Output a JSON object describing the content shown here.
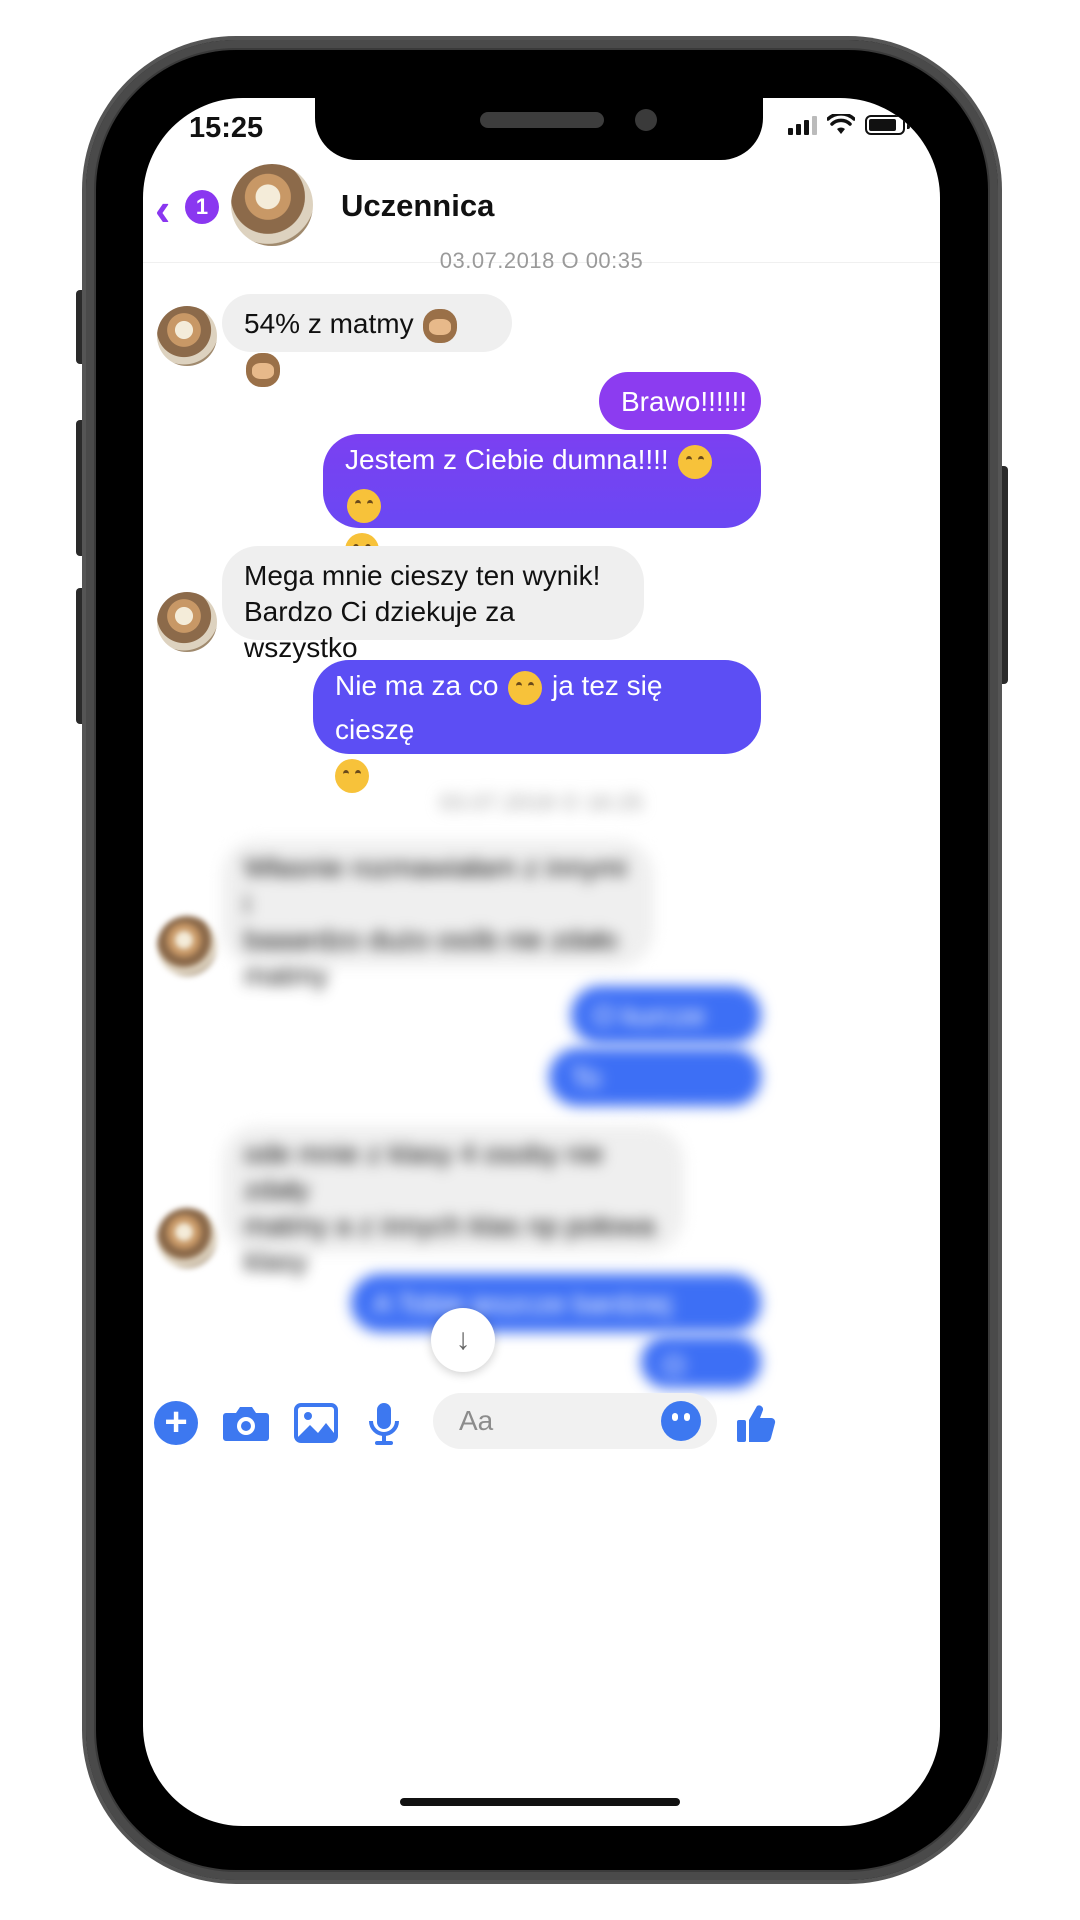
{
  "status_bar": {
    "time": "15:25"
  },
  "header": {
    "back_badge_count": "1",
    "contact_name": "Uczennica"
  },
  "conversation": {
    "timestamp_1": "03.07.2018 O 00:35",
    "timestamp_2": "03.07.2018 O 16:25",
    "messages": [
      {
        "direction": "in",
        "text": "54% z matmy",
        "emoji": [
          "see-no-evil-monkey",
          "see-no-evil-monkey"
        ]
      },
      {
        "direction": "out",
        "text": "Brawo!!!!!!"
      },
      {
        "direction": "out",
        "text": "Jestem z Ciebie dumna!!!!",
        "emoji": [
          "smiling-face",
          "smiling-face",
          "smiling-face"
        ]
      },
      {
        "direction": "in",
        "text_line_1": "Mega mnie cieszy ten wynik!",
        "text_line_2": "Bardzo Ci dziekuje za wszystko"
      },
      {
        "direction": "out",
        "text_before": "Nie ma za co",
        "text_after": "ja tez się cieszę",
        "emoji": [
          "smiling-face",
          "grinning-face"
        ]
      },
      {
        "direction": "in",
        "blurred": true,
        "text_line_1": "Własnie rozmawiałam z innymi i",
        "text_line_2": "baaardzo dużo osób nie zdało",
        "text_line_3": "matmy"
      },
      {
        "direction": "out",
        "blurred": true,
        "text": "O kurcze"
      },
      {
        "direction": "out",
        "blurred": true,
        "text": "To współczuję"
      },
      {
        "direction": "in",
        "blurred": true,
        "text_line_1": "ode mnie z klasy 4 osoby nie zdały",
        "text_line_2": "matmy a z innych klas np połowa",
        "text_line_3": "klasy"
      },
      {
        "direction": "out",
        "blurred": true,
        "text": "A Tobie jeszcze bardziej gratuluję"
      },
      {
        "direction": "out",
        "blurred": true,
        "text": "O jacie"
      }
    ]
  },
  "composer": {
    "placeholder": "Aa",
    "icons": [
      "plus-icon",
      "camera-icon",
      "gallery-icon",
      "microphone-icon",
      "emoji-icon",
      "thumbs-up-icon"
    ]
  },
  "colors": {
    "accent_purple": "#8a37f0",
    "bubble_purple": "#8c3cf0",
    "bubble_violet": "#5c4ef4",
    "bubble_blue": "#3d6ff5",
    "bubble_incoming": "#efefef",
    "icon_blue": "#3d78f0"
  }
}
